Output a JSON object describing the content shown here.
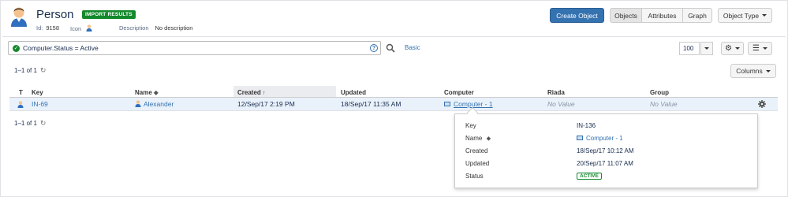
{
  "object_type": {
    "name": "Person",
    "badge": "IMPORT RESULTS",
    "id_label": "Id:",
    "id_value": "9158",
    "icon_label": "Icon",
    "description_label": "Description",
    "description_value": "No description"
  },
  "toolbar": {
    "create_object": "Create Object",
    "tabs": [
      "Objects",
      "Attributes",
      "Graph"
    ],
    "object_type_dropdown": "Object Type"
  },
  "search": {
    "query": "Computer.Status = Active",
    "help_icon": "?",
    "basic_link": "Basic",
    "page_size": "100"
  },
  "results": {
    "count_top": "1–1 of 1",
    "count_bottom": "1–1 of 1",
    "columns_button": "Columns"
  },
  "table": {
    "headers": [
      "T",
      "Key",
      "Name",
      "Created",
      "Updated",
      "Computer",
      "Riada",
      "Group"
    ],
    "rows": [
      {
        "key": "IN-69",
        "name": "Alexander",
        "created": "12/Sep/17 2:19 PM",
        "updated": "18/Sep/17 11:35 AM",
        "computer": "Computer - 1",
        "riada": "No Value",
        "group": "No Value"
      }
    ]
  },
  "popup": {
    "labels": [
      "Key",
      "Name",
      "Created",
      "Updated",
      "Status"
    ],
    "key": "IN-136",
    "name": "Computer - 1",
    "created": "18/Sep/17 10:12 AM",
    "updated": "20/Sep/17 11:07 AM",
    "status": "ACTIVE"
  },
  "colors": {
    "primary": "#3572b0",
    "success": "#14892c",
    "muted": "#8993a4"
  }
}
